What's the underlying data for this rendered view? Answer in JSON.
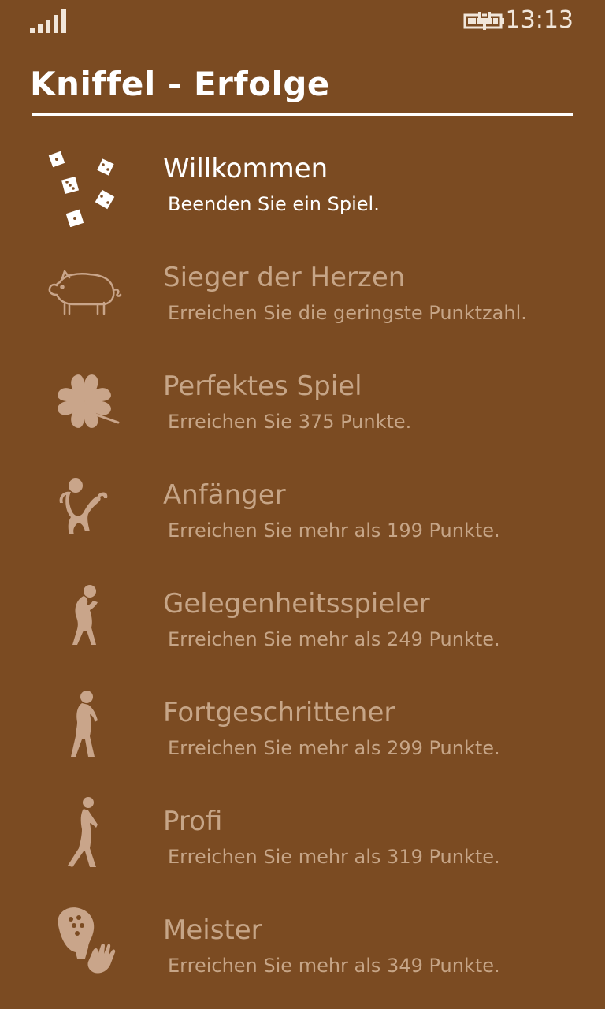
{
  "status_bar": {
    "time": "13:13",
    "signal_icon": "signal-strength-icon",
    "battery_icon": "battery-charging-icon"
  },
  "header": {
    "title": "Kniffel - Erfolge"
  },
  "colors": {
    "background": "#7b4b22",
    "unlocked_text": "#ffffff",
    "locked_text": "#c6a587",
    "locked_icon": "#c9a58a"
  },
  "achievements": [
    {
      "name": "Willkommen",
      "description": "Beenden Sie ein Spiel.",
      "icon": "dice-icon",
      "unlocked": true
    },
    {
      "name": "Sieger der Herzen",
      "description": "Erreichen Sie die geringste Punktzahl.",
      "icon": "pig-icon",
      "unlocked": false
    },
    {
      "name": "Perfektes Spiel",
      "description": "Erreichen Sie 375 Punkte.",
      "icon": "four-leaf-clover-icon",
      "unlocked": false
    },
    {
      "name": "Anfänger",
      "description": "Erreichen Sie mehr als 199 Punkte.",
      "icon": "monkey-icon",
      "unlocked": false
    },
    {
      "name": "Gelegenheitsspieler",
      "description": "Erreichen Sie mehr als 249 Punkte.",
      "icon": "ape-icon",
      "unlocked": false
    },
    {
      "name": "Fortgeschrittener",
      "description": "Erreichen Sie mehr als 299 Punkte.",
      "icon": "early-human-icon",
      "unlocked": false
    },
    {
      "name": "Profi",
      "description": "Erreichen Sie mehr als 319 Punkte.",
      "icon": "walking-human-icon",
      "unlocked": false
    },
    {
      "name": "Meister",
      "description": "Erreichen Sie mehr als 349 Punkte.",
      "icon": "dice-head-icon",
      "unlocked": false
    }
  ]
}
